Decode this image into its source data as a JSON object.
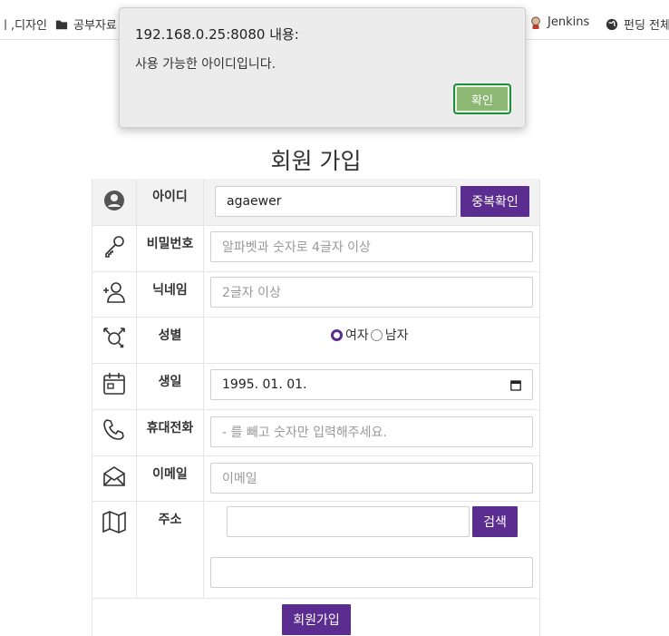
{
  "bookmarks": [
    {
      "label": "ㅣ,디자인",
      "icon": "none"
    },
    {
      "label": "공부자료",
      "icon": "folder-icon"
    },
    {
      "label": "Jenkins",
      "icon": "jenkins-icon"
    },
    {
      "label": "펀딩 전체",
      "icon": "globe-icon"
    }
  ],
  "dialog": {
    "title": "192.168.0.25:8080 내용:",
    "message": "사용 가능한 아이디입니다.",
    "ok_label": "확인"
  },
  "form": {
    "title": "회원 가입",
    "id": {
      "label": "아이디",
      "value": "agaewer",
      "check_button": "중복확인"
    },
    "password": {
      "label": "비밀번호",
      "placeholder": "알파벳과 숫자로 4글자 이상"
    },
    "nickname": {
      "label": "닉네임",
      "placeholder": "2글자 이상"
    },
    "gender": {
      "label": "성별",
      "options": [
        "여자",
        "남자"
      ],
      "selected": "여자"
    },
    "birth": {
      "label": "생일",
      "value": "1995. 01. 01."
    },
    "phone": {
      "label": "휴대전화",
      "placeholder": "- 를 빼고 숫자만 입력해주세요."
    },
    "email": {
      "label": "이메일",
      "placeholder": "이메일"
    },
    "address": {
      "label": "주소",
      "search_button": "검색",
      "value1": "",
      "value2": ""
    },
    "submit_label": "회원가입"
  },
  "colors": {
    "accent": "#5c2d91",
    "ok_button": "#8cb873",
    "row_shade": "#f2f2f2"
  }
}
